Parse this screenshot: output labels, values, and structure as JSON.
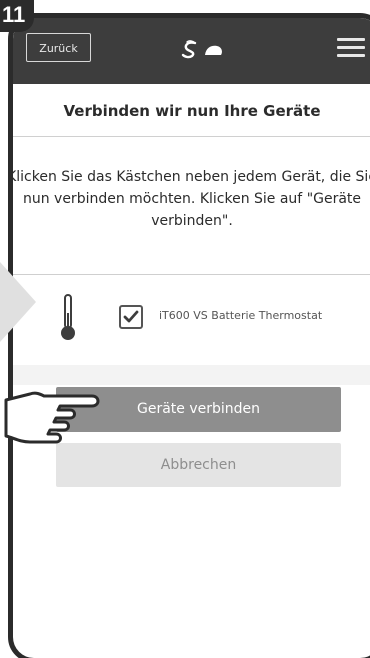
{
  "step": {
    "number": "11"
  },
  "header": {
    "back_label": "Zurück",
    "logo_icon": "salus-logo-icon",
    "menu_icon": "hamburger-menu-icon"
  },
  "main": {
    "title": "Verbinden wir nun Ihre Geräte",
    "instructions": "Klicken Sie das Kästchen neben jedem Gerät, die Sie nun verbinden möchten. Klicken Sie auf \"Geräte verbinden\".",
    "devices": [
      {
        "icon": "thermometer-icon",
        "checked": true,
        "label": "iT600 VS Batterie Thermostat"
      }
    ],
    "connect_button_label": "Geräte verbinden",
    "cancel_button_label": "Abbrechen"
  },
  "colors": {
    "header_bg": "#3d3d3d",
    "primary_button_bg": "#8e8e8e",
    "secondary_button_bg": "#e4e4e4"
  }
}
